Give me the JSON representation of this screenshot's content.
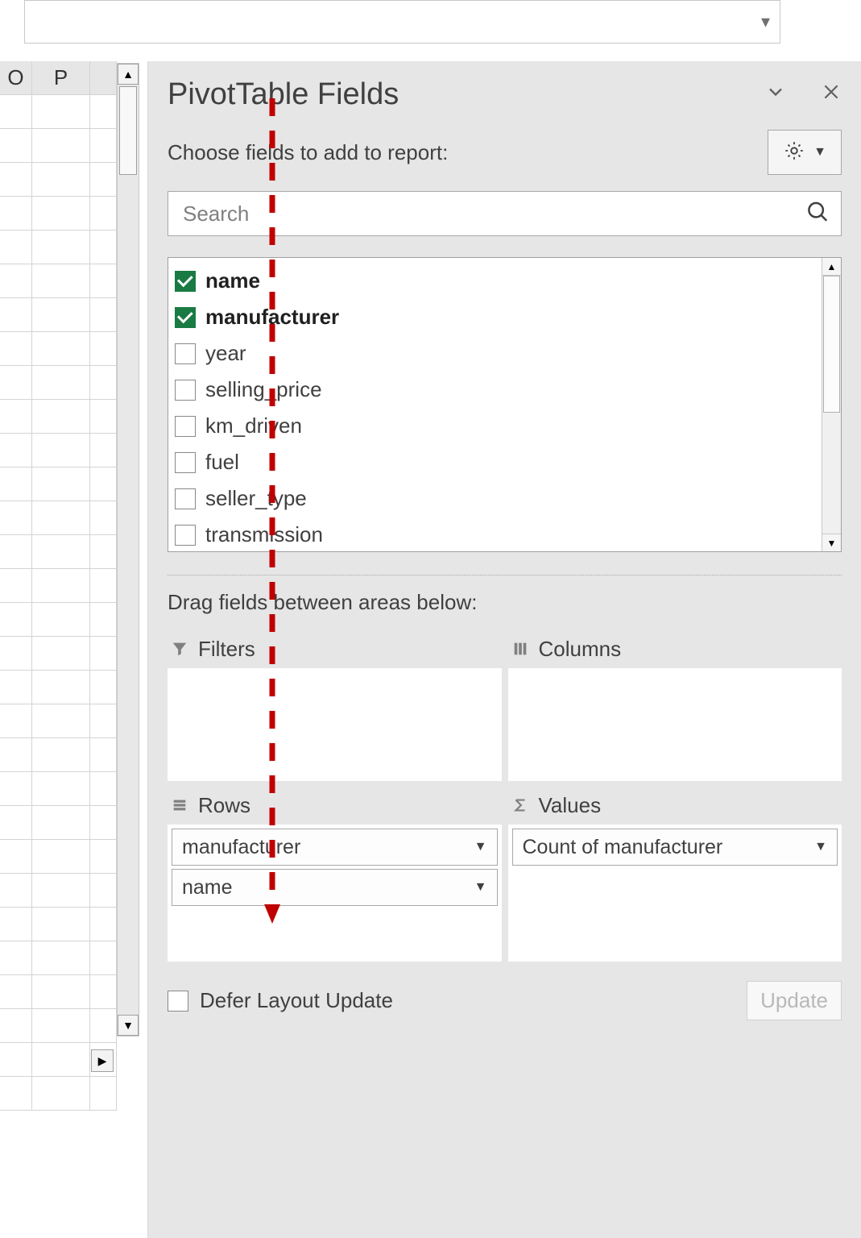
{
  "column_headers": [
    "O",
    "P"
  ],
  "pane": {
    "title": "PivotTable Fields",
    "choose_label": "Choose fields to add to report:",
    "search_placeholder": "Search",
    "drag_label": "Drag fields between areas below:",
    "fields": [
      {
        "label": "name",
        "checked": true
      },
      {
        "label": "manufacturer",
        "checked": true
      },
      {
        "label": "year",
        "checked": false
      },
      {
        "label": "selling_price",
        "checked": false
      },
      {
        "label": "km_driven",
        "checked": false
      },
      {
        "label": "fuel",
        "checked": false
      },
      {
        "label": "seller_type",
        "checked": false
      },
      {
        "label": "transmission",
        "checked": false
      }
    ],
    "areas": {
      "filters_label": "Filters",
      "columns_label": "Columns",
      "rows_label": "Rows",
      "values_label": "Values",
      "rows_items": [
        "manufacturer",
        "name"
      ],
      "values_items": [
        "Count of manufacturer"
      ]
    },
    "defer_label": "Defer Layout Update",
    "update_label": "Update"
  }
}
